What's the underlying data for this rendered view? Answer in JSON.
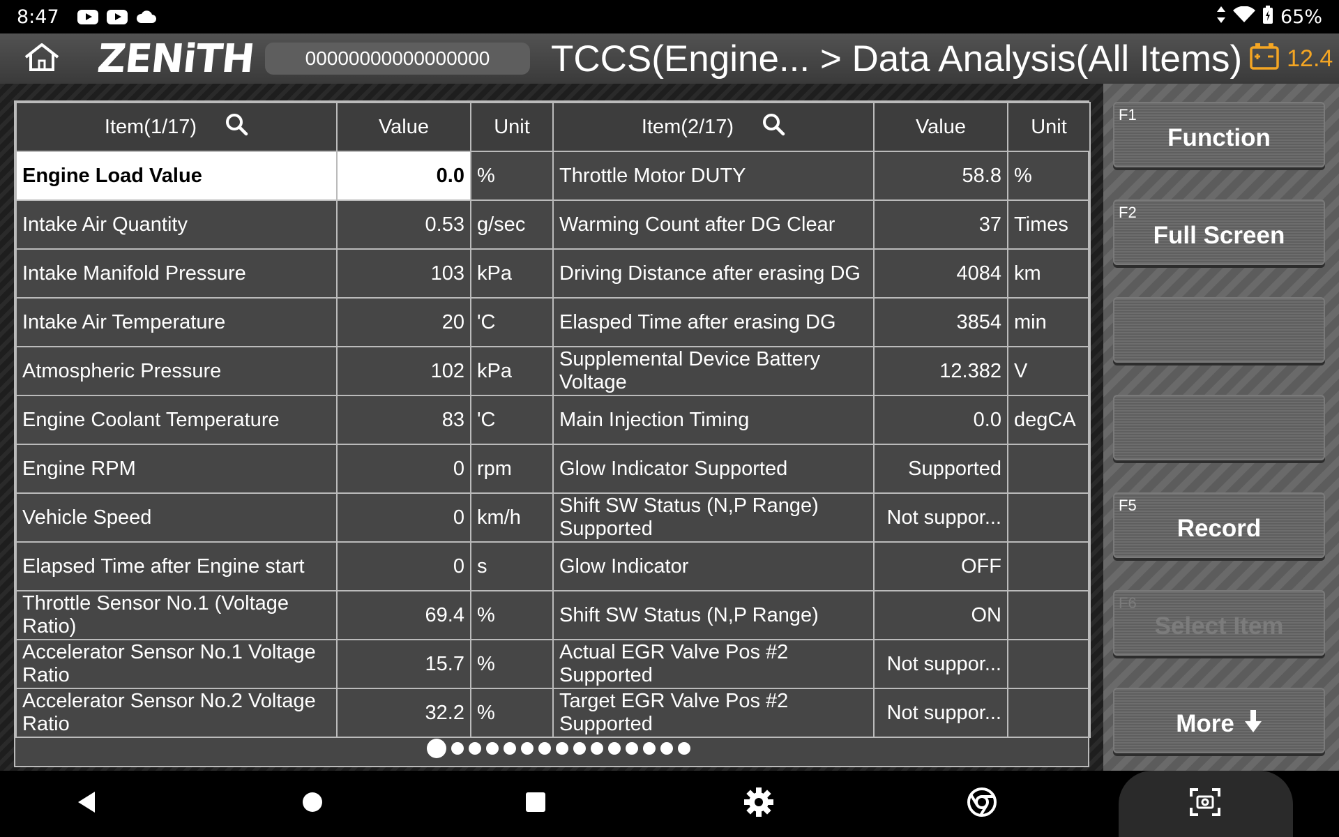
{
  "status_bar": {
    "time": "8:47",
    "battery_pct": "65%",
    "icons": [
      "youtube-icon",
      "youtube-icon",
      "cloud-icon",
      "data-arrows-icon",
      "wifi-icon",
      "battery-icon"
    ]
  },
  "header": {
    "logo": "ZENiTH",
    "vin": "00000000000000000",
    "title": "TCCS(Engine... > Data Analysis(All Items)",
    "battery_voltage": "12.4",
    "accent_color": "#f5a623"
  },
  "table": {
    "left_header": {
      "item": "Item(1/17)",
      "value": "Value",
      "unit": "Unit"
    },
    "right_header": {
      "item": "Item(2/17)",
      "value": "Value",
      "unit": "Unit"
    },
    "rows": [
      {
        "item1": "Engine Load Value",
        "value1": "0.0",
        "unit1": "%",
        "item2": "Throttle Motor DUTY",
        "value2": "58.8",
        "unit2": "%"
      },
      {
        "item1": "Intake Air Quantity",
        "value1": "0.53",
        "unit1": "g/sec",
        "item2": "Warming Count after DG Clear",
        "value2": "37",
        "unit2": "Times"
      },
      {
        "item1": "Intake Manifold Pressure",
        "value1": "103",
        "unit1": "kPa",
        "item2": "Driving Distance after erasing DG",
        "value2": "4084",
        "unit2": "km"
      },
      {
        "item1": "Intake Air Temperature",
        "value1": "20",
        "unit1": "'C",
        "item2": "Elasped Time after erasing DG",
        "value2": "3854",
        "unit2": "min"
      },
      {
        "item1": "Atmospheric Pressure",
        "value1": "102",
        "unit1": "kPa",
        "item2": "Supplemental Device Battery Voltage",
        "value2": "12.382",
        "unit2": "V"
      },
      {
        "item1": "Engine Coolant Temperature",
        "value1": "83",
        "unit1": "'C",
        "item2": "Main Injection Timing",
        "value2": "0.0",
        "unit2": "degCA"
      },
      {
        "item1": "Engine RPM",
        "value1": "0",
        "unit1": "rpm",
        "item2": "Glow Indicator Supported",
        "value2": "Supported",
        "unit2": ""
      },
      {
        "item1": "Vehicle Speed",
        "value1": "0",
        "unit1": "km/h",
        "item2": "Shift SW Status (N,P Range) Supported",
        "value2": "Not suppor...",
        "unit2": ""
      },
      {
        "item1": "Elapsed Time after Engine start",
        "value1": "0",
        "unit1": "s",
        "item2": "Glow Indicator",
        "value2": "OFF",
        "unit2": ""
      },
      {
        "item1": "Throttle Sensor No.1 (Voltage Ratio)",
        "value1": "69.4",
        "unit1": "%",
        "item2": "Shift SW Status (N,P Range)",
        "value2": "ON",
        "unit2": ""
      },
      {
        "item1": "Accelerator Sensor No.1 Voltage Ratio",
        "value1": "15.7",
        "unit1": "%",
        "item2": "Actual EGR Valve Pos #2 Supported",
        "value2": "Not suppor...",
        "unit2": ""
      },
      {
        "item1": "Accelerator Sensor No.2 Voltage Ratio",
        "value1": "32.2",
        "unit1": "%",
        "item2": "Target EGR Valve Pos #2 Supported",
        "value2": "Not suppor...",
        "unit2": ""
      }
    ],
    "selected_row": 0,
    "pages": {
      "total": 15,
      "current": 1
    }
  },
  "function_panel": {
    "buttons": [
      {
        "key": "F1",
        "label": "Function",
        "enabled": true
      },
      {
        "key": "F2",
        "label": "Full Screen",
        "enabled": true
      },
      {
        "key": "",
        "label": "",
        "enabled": true
      },
      {
        "key": "",
        "label": "",
        "enabled": true
      },
      {
        "key": "F5",
        "label": "Record",
        "enabled": true
      },
      {
        "key": "F6",
        "label": "Select Item",
        "enabled": false
      },
      {
        "key": "",
        "label": "More",
        "enabled": true
      }
    ]
  },
  "nav_bar": {
    "icons": [
      "back-icon",
      "home-circle-icon",
      "recents-icon",
      "settings-icon",
      "chrome-icon",
      "screenshot-icon"
    ]
  }
}
